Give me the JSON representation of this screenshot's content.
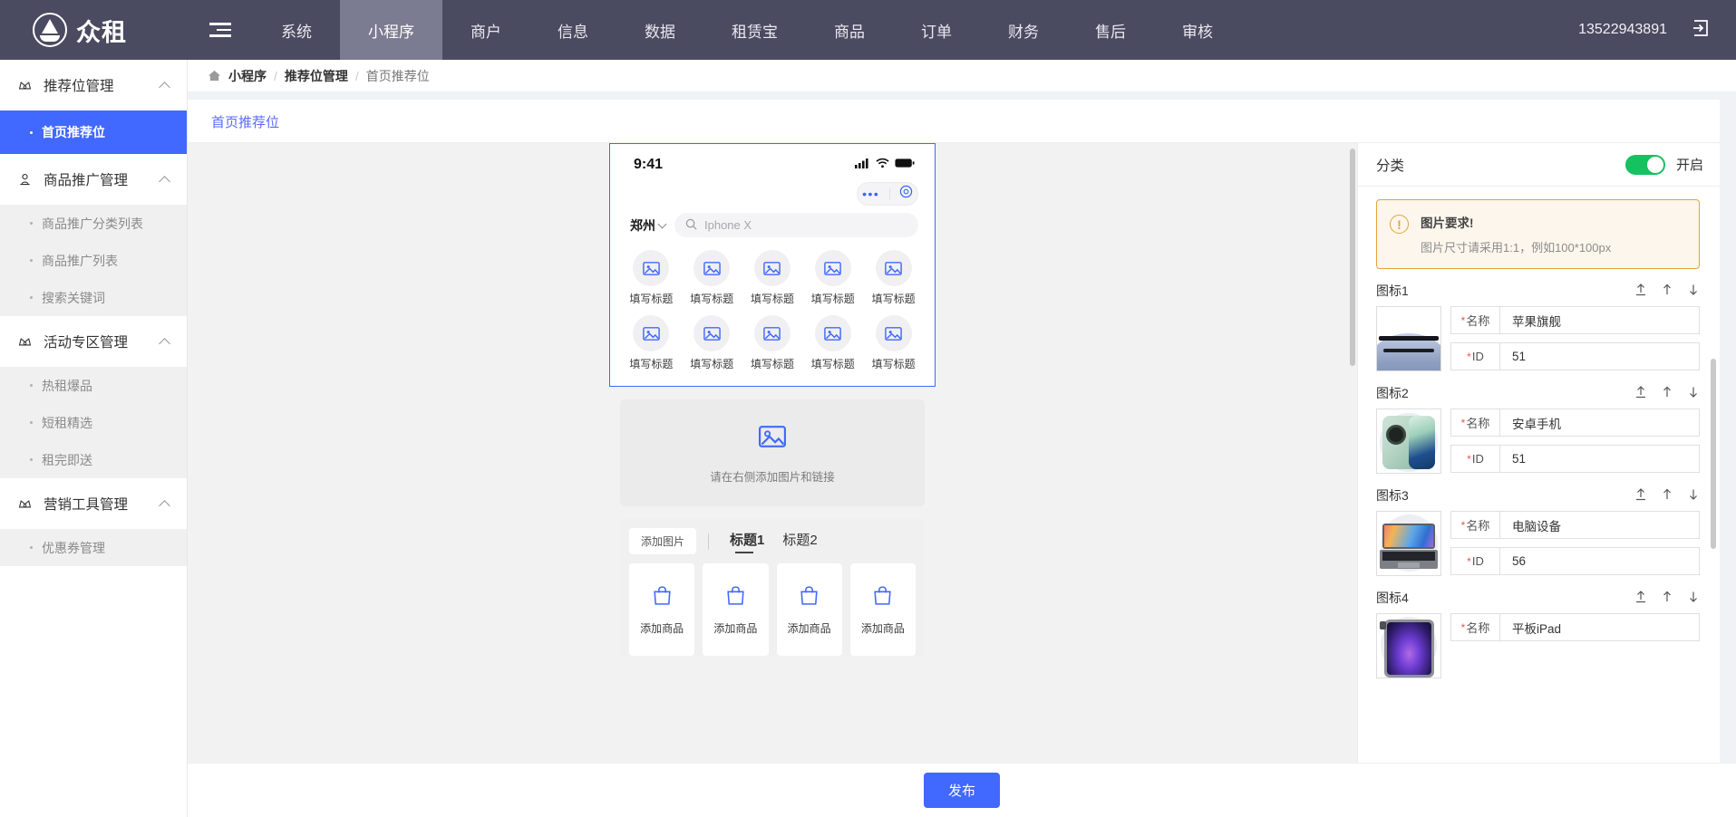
{
  "topnav": {
    "brand": "众租",
    "hamburger_icon": "hamburger-menu-icon",
    "items": [
      {
        "label": "系统",
        "active": false
      },
      {
        "label": "小程序",
        "active": true
      },
      {
        "label": "商户",
        "active": false
      },
      {
        "label": "信息",
        "active": false
      },
      {
        "label": "数据",
        "active": false
      },
      {
        "label": "租赁宝",
        "active": false
      },
      {
        "label": "商品",
        "active": false
      },
      {
        "label": "订单",
        "active": false
      },
      {
        "label": "财务",
        "active": false
      },
      {
        "label": "售后",
        "active": false
      },
      {
        "label": "审核",
        "active": false
      }
    ],
    "phone": "13522943891",
    "logout_icon": "logout-icon"
  },
  "sidebar": {
    "groups": [
      {
        "label": "推荐位管理",
        "icon": "crown-icon",
        "items": [
          {
            "label": "首页推荐位",
            "active": true
          }
        ]
      },
      {
        "label": "商品推广管理",
        "icon": "stamp-icon",
        "items": [
          {
            "label": "商品推广分类列表",
            "active": false
          },
          {
            "label": "商品推广列表",
            "active": false
          },
          {
            "label": "搜索关键词",
            "active": false
          }
        ]
      },
      {
        "label": "活动专区管理",
        "icon": "crown-icon",
        "items": [
          {
            "label": "热租爆品",
            "active": false
          },
          {
            "label": "短租精选",
            "active": false
          },
          {
            "label": "租完即送",
            "active": false
          }
        ]
      },
      {
        "label": "营销工具管理",
        "icon": "crown-icon",
        "items": [
          {
            "label": "优惠券管理",
            "active": false
          }
        ]
      }
    ]
  },
  "breadcrumb": {
    "home_icon": "home-icon",
    "items": [
      "小程序",
      "推荐位管理",
      "首页推荐位"
    ],
    "separator": "/"
  },
  "panel": {
    "title": "首页推荐位"
  },
  "preview": {
    "status_time": "9:41",
    "signal_icon": "cellular-signal-icon",
    "wifi_icon": "wifi-icon",
    "battery_icon": "battery-icon",
    "capsule_more_icon": "more-dots-icon",
    "capsule_target_icon": "target-circle-icon",
    "city": "郑州",
    "city_chevron_icon": "chevron-down-icon",
    "search_icon": "search-icon",
    "search_placeholder": "Iphone X",
    "grid_icon": "image-placeholder-icon",
    "grid_labels": [
      "填写标题",
      "填写标题",
      "填写标题",
      "填写标题",
      "填写标题",
      "填写标题",
      "填写标题",
      "填写标题",
      "填写标题",
      "填写标题"
    ],
    "banner_icon": "image-placeholder-icon",
    "banner_text": "请在右侧添加图片和链接",
    "add_picture_label": "添加图片",
    "tabs": [
      {
        "label": "标题1",
        "selected": true
      },
      {
        "label": "标题2",
        "selected": false
      }
    ],
    "product_icon": "shopping-bag-icon",
    "products": [
      "添加商品",
      "添加商品",
      "添加商品",
      "添加商品"
    ]
  },
  "right_panel": {
    "title": "分类",
    "switch_on": true,
    "switch_label": "开启",
    "notice": {
      "icon": "warning-circle-icon",
      "title": "图片要求!",
      "text": "图片尺寸请采用1:1，例如100*100px"
    },
    "arrow_icons": [
      "upload-arrow-icon",
      "arrow-up-icon",
      "arrow-down-icon"
    ],
    "field_labels": {
      "name": "名称",
      "id": "ID",
      "required_mark": "*"
    },
    "entries": [
      {
        "label": "图标1",
        "thumb": "apple-iphone-thumb",
        "name": "苹果旗舰",
        "id": "51"
      },
      {
        "label": "图标2",
        "thumb": "android-phone-thumb",
        "name": "安卓手机",
        "id": "51"
      },
      {
        "label": "图标3",
        "thumb": "laptop-thumb",
        "name": "电脑设备",
        "id": "56"
      },
      {
        "label": "图标4",
        "thumb": "ipad-thumb",
        "name": "平板iPad",
        "id": ""
      }
    ]
  },
  "footer": {
    "publish_label": "发布"
  },
  "colors": {
    "topbar": "#4a4a61",
    "accent": "#4168ff",
    "switch_on": "#16c160",
    "notice_border": "#e8a23a",
    "notice_bg": "#fdf6ec",
    "required": "#f05252"
  }
}
